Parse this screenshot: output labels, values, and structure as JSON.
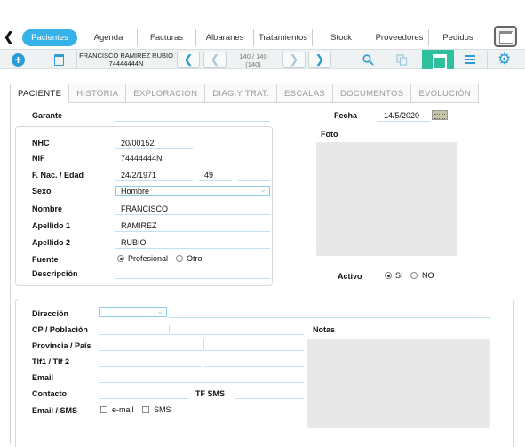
{
  "nav": {
    "tabs": [
      {
        "label": "Pacientes",
        "active": true
      },
      {
        "label": "Agenda"
      },
      {
        "label": "Facturas"
      },
      {
        "label": "Albaranes"
      },
      {
        "label": "Tratamientos"
      },
      {
        "label": "Stock"
      },
      {
        "label": "Proveedores"
      },
      {
        "label": "Pedidos"
      }
    ]
  },
  "toolbar": {
    "patient_name": "FRANCISCO RAMIREZ RUBIO",
    "patient_id": "74444444N",
    "record_position": "140 / 140",
    "record_count": "(140)",
    "icons": [
      "add-icon",
      "trash-icon",
      "prev-icon",
      "next-icon",
      "search-icon",
      "copy-icon",
      "card-view-icon",
      "list-view-icon",
      "gear-icon"
    ]
  },
  "subtabs": [
    "PACIENTE",
    "HISTORIA",
    "EXPLORACION",
    "DIAG.Y TRAT.",
    "ESCALAS",
    "DOCUMENTOS",
    "EVOLUCIÓN"
  ],
  "form": {
    "garante_label": "Garante",
    "fecha_label": "Fecha",
    "fecha_value": "14/5/2020",
    "foto_label": "Foto",
    "nhc_label": "NHC",
    "nhc_value": "20/00152",
    "nif_label": "NIF",
    "nif_value": "74444444N",
    "fnac_label": "F. Nac. / Edad",
    "fnac_value": "24/2/1971",
    "edad_value": "49",
    "sexo_label": "Sexo",
    "sexo_value": "Hombre",
    "nombre_label": "Nombre",
    "nombre_value": "FRANCISCO",
    "apellido1_label": "Apellido 1",
    "apellido1_value": "RAMIREZ",
    "apellido2_label": "Apellido 2",
    "apellido2_value": "RUBIO",
    "fuente_label": "Fuente",
    "fuente_opt1": "Profesional",
    "fuente_opt2": "Otro",
    "descripcion_label": "Descripción",
    "activo_label": "Activo",
    "activo_si": "SI",
    "activo_no": "NO",
    "direccion_label": "Dirección",
    "cp_label": "CP / Población",
    "provincia_label": "Provincia / País",
    "tlf_label": "Tlf1 / Tlf 2",
    "email_label": "Email",
    "contacto_label": "Contacto",
    "tfsms_label": "TF SMS",
    "emailsms_label": "Email / SMS",
    "emailsms_opt1": "e-mail",
    "emailsms_opt2": "SMS",
    "notas_label": "Notas"
  }
}
